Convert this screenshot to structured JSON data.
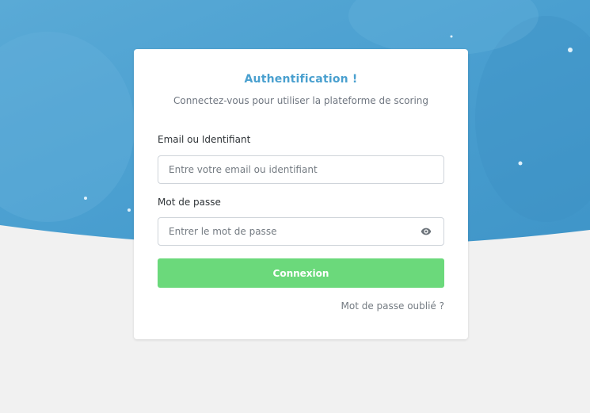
{
  "colors": {
    "hero_blue": "#4a9fd0",
    "title_blue": "#4aa0cf",
    "button_green": "#6bd97b",
    "page_background": "#f1f1f1"
  },
  "login": {
    "title": "Authentification !",
    "subtitle": "Connectez-vous pour utiliser la plateforme de scoring",
    "email_label": "Email ou Identifiant",
    "email_placeholder": "Entre votre email ou identifiant",
    "password_label": "Mot de passe",
    "password_placeholder": "Entrer le mot de passe",
    "password_toggle_icon": "eye-icon",
    "submit_label": "Connexion",
    "forgot_label": "Mot de passe oublié ?"
  }
}
